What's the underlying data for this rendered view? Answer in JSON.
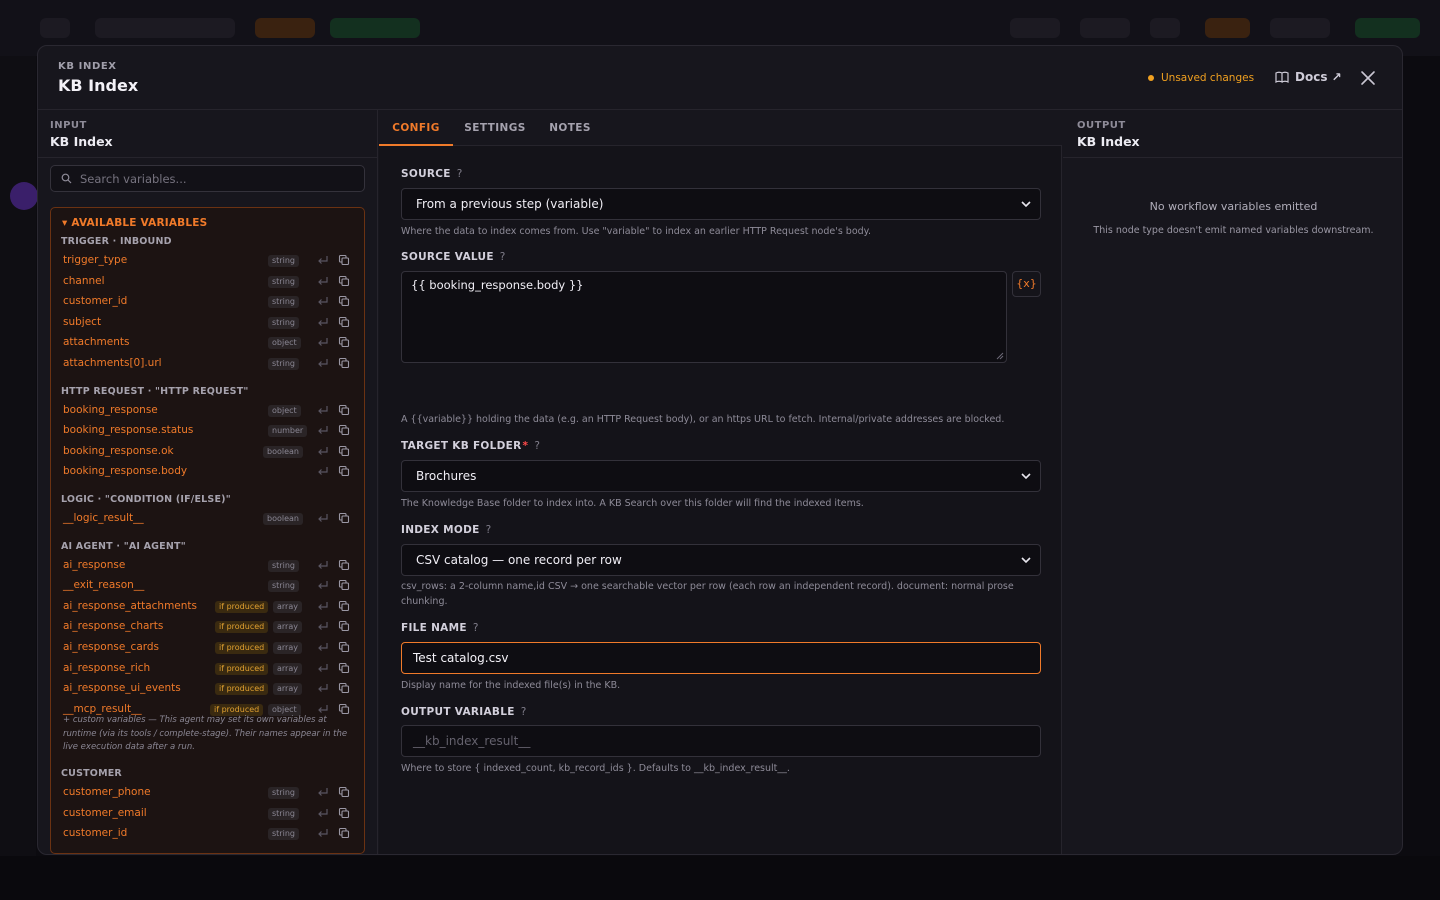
{
  "header": {
    "eyebrow": "KB INDEX",
    "title": "KB Index",
    "unsaved": "Unsaved changes",
    "docs": "Docs ↗"
  },
  "input_panel": {
    "label": "INPUT",
    "value": "KB Index",
    "search_placeholder": "Search variables...",
    "section_title": "▾ AVAILABLE VARIABLES",
    "groups": [
      {
        "title": "TRIGGER · INBOUND",
        "vars": [
          {
            "name": "trigger_type",
            "type": "string"
          },
          {
            "name": "channel",
            "type": "string"
          },
          {
            "name": "customer_id",
            "type": "string"
          },
          {
            "name": "subject",
            "type": "string"
          },
          {
            "name": "attachments",
            "type": "object"
          },
          {
            "name": "attachments[0].url",
            "type": "string"
          }
        ]
      },
      {
        "title": "HTTP REQUEST · \"HTTP REQUEST\"",
        "vars": [
          {
            "name": "booking_response",
            "type": "object"
          },
          {
            "name": "booking_response.status",
            "type": "number"
          },
          {
            "name": "booking_response.ok",
            "type": "boolean"
          },
          {
            "name": "booking_response.body",
            "type": ""
          }
        ]
      },
      {
        "title": "LOGIC · \"CONDITION (IF/ELSE)\"",
        "vars": [
          {
            "name": "__logic_result__",
            "type": "boolean"
          }
        ]
      },
      {
        "title": "AI AGENT · \"AI AGENT\"",
        "vars": [
          {
            "name": "ai_response",
            "type": "string"
          },
          {
            "name": "__exit_reason__",
            "type": "string"
          },
          {
            "name": "ai_response_attachments",
            "type": "array",
            "badge": "if produced"
          },
          {
            "name": "ai_response_charts",
            "type": "array",
            "badge": "if produced"
          },
          {
            "name": "ai_response_cards",
            "type": "array",
            "badge": "if produced"
          },
          {
            "name": "ai_response_rich",
            "type": "array",
            "badge": "if produced"
          },
          {
            "name": "ai_response_ui_events",
            "type": "array",
            "badge": "if produced"
          },
          {
            "name": "__mcp_result__",
            "type": "object",
            "badge": "if produced"
          }
        ]
      },
      {
        "title": "CUSTOMER",
        "vars": [
          {
            "name": "customer_phone",
            "type": "string"
          },
          {
            "name": "customer_email",
            "type": "string"
          },
          {
            "name": "customer_id",
            "type": "string"
          }
        ]
      }
    ],
    "custom_note": "+ custom variables — This agent may set its own variables at runtime (via its tools / complete-stage). Their names appear in the live execution data after a run."
  },
  "tabs": [
    "CONFIG",
    "SETTINGS",
    "NOTES"
  ],
  "config": {
    "source": {
      "label": "SOURCE",
      "value": "From a previous step (variable)",
      "help": "Where the data to index comes from. Use \"variable\" to index an earlier HTTP Request node's body."
    },
    "source_value": {
      "label": "SOURCE VALUE",
      "value": "{{ booking_response.body }}",
      "var_button": "{x}",
      "help": "A {{variable}} holding the data (e.g. an HTTP Request body), or an https URL to fetch. Internal/private addresses are blocked."
    },
    "target_folder": {
      "label": "TARGET KB FOLDER",
      "required": "*",
      "value": "Brochures",
      "help": "The Knowledge Base folder to index into. A KB Search over this folder will find the indexed items."
    },
    "index_mode": {
      "label": "INDEX MODE",
      "value": "CSV catalog — one record per row",
      "help": "csv_rows: a 2-column name,id CSV → one searchable vector per row (each row an independent record). document: normal prose chunking."
    },
    "file_name": {
      "label": "FILE NAME",
      "value": "Test catalog.csv",
      "help": "Display name for the indexed file(s) in the KB."
    },
    "output_variable": {
      "label": "OUTPUT VARIABLE",
      "placeholder": "__kb_index_result__",
      "help": "Where to store { indexed_count, kb_record_ids }. Defaults to __kb_index_result__."
    }
  },
  "output_panel": {
    "label": "OUTPUT",
    "value": "KB Index",
    "empty_title": "No workflow variables emitted",
    "empty_sub": "This node type doesn't emit named variables downstream."
  },
  "colors": {
    "accent": "#f07a2a",
    "warning": "#f0a020",
    "required": "#ff4a4a"
  }
}
